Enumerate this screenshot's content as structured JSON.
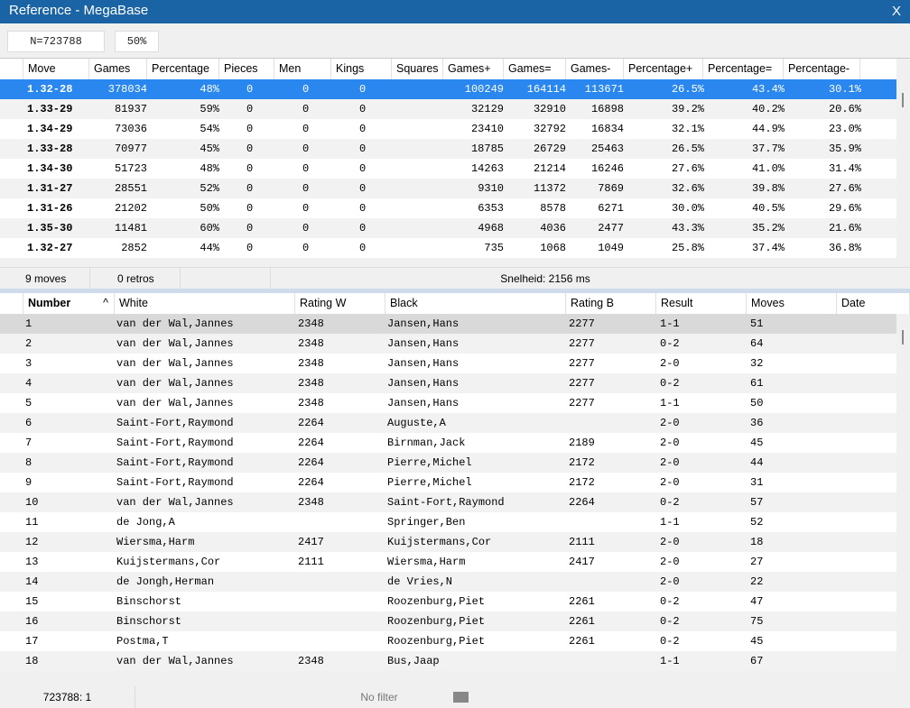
{
  "window": {
    "title": "Reference - MegaBase",
    "close_label": "X"
  },
  "toolbar": {
    "count_label": "N=723788",
    "percent_label": "50%"
  },
  "moves_table": {
    "columns": [
      "Move",
      "Games",
      "Percentage",
      "Pieces",
      "Men",
      "Kings",
      "Squares",
      "Games+",
      "Games=",
      "Games-",
      "Percentage+",
      "Percentage=",
      "Percentage-"
    ],
    "rows": [
      [
        "1.32-28",
        "378034",
        "48%",
        "0",
        "0",
        "0",
        "",
        "100249",
        "164114",
        "113671",
        "26.5%",
        "43.4%",
        "30.1%"
      ],
      [
        "1.33-29",
        "81937",
        "59%",
        "0",
        "0",
        "0",
        "",
        "32129",
        "32910",
        "16898",
        "39.2%",
        "40.2%",
        "20.6%"
      ],
      [
        "1.34-29",
        "73036",
        "54%",
        "0",
        "0",
        "0",
        "",
        "23410",
        "32792",
        "16834",
        "32.1%",
        "44.9%",
        "23.0%"
      ],
      [
        "1.33-28",
        "70977",
        "45%",
        "0",
        "0",
        "0",
        "",
        "18785",
        "26729",
        "25463",
        "26.5%",
        "37.7%",
        "35.9%"
      ],
      [
        "1.34-30",
        "51723",
        "48%",
        "0",
        "0",
        "0",
        "",
        "14263",
        "21214",
        "16246",
        "27.6%",
        "41.0%",
        "31.4%"
      ],
      [
        "1.31-27",
        "28551",
        "52%",
        "0",
        "0",
        "0",
        "",
        "9310",
        "11372",
        "7869",
        "32.6%",
        "39.8%",
        "27.6%"
      ],
      [
        "1.31-26",
        "21202",
        "50%",
        "0",
        "0",
        "0",
        "",
        "6353",
        "8578",
        "6271",
        "30.0%",
        "40.5%",
        "29.6%"
      ],
      [
        "1.35-30",
        "11481",
        "60%",
        "0",
        "0",
        "0",
        "",
        "4968",
        "4036",
        "2477",
        "43.3%",
        "35.2%",
        "21.6%"
      ],
      [
        "1.32-27",
        "2852",
        "44%",
        "0",
        "0",
        "0",
        "",
        "735",
        "1068",
        "1049",
        "25.8%",
        "37.4%",
        "36.8%"
      ]
    ],
    "selected_index": 0
  },
  "status_top": {
    "moves": "9 moves",
    "retros": "0 retros",
    "speed": "Snelheid: 2156 ms"
  },
  "games_table": {
    "columns": [
      "Number",
      "White",
      "Rating W",
      "Black",
      "Rating B",
      "Result",
      "Moves",
      "Date"
    ],
    "sort_indicator": "^",
    "rows": [
      [
        "1",
        "van der Wal,Jannes",
        "2348",
        "Jansen,Hans",
        "2277",
        "1-1",
        "51",
        ""
      ],
      [
        "2",
        "van der Wal,Jannes",
        "2348",
        "Jansen,Hans",
        "2277",
        "0-2",
        "64",
        ""
      ],
      [
        "3",
        "van der Wal,Jannes",
        "2348",
        "Jansen,Hans",
        "2277",
        "2-0",
        "32",
        ""
      ],
      [
        "4",
        "van der Wal,Jannes",
        "2348",
        "Jansen,Hans",
        "2277",
        "0-2",
        "61",
        ""
      ],
      [
        "5",
        "van der Wal,Jannes",
        "2348",
        "Jansen,Hans",
        "2277",
        "1-1",
        "50",
        ""
      ],
      [
        "6",
        "Saint-Fort,Raymond",
        "2264",
        "Auguste,A",
        "",
        "2-0",
        "36",
        ""
      ],
      [
        "7",
        "Saint-Fort,Raymond",
        "2264",
        "Birnman,Jack",
        "2189",
        "2-0",
        "45",
        ""
      ],
      [
        "8",
        "Saint-Fort,Raymond",
        "2264",
        "Pierre,Michel",
        "2172",
        "2-0",
        "44",
        ""
      ],
      [
        "9",
        "Saint-Fort,Raymond",
        "2264",
        "Pierre,Michel",
        "2172",
        "2-0",
        "31",
        ""
      ],
      [
        "10",
        "van der Wal,Jannes",
        "2348",
        "Saint-Fort,Raymond",
        "2264",
        "0-2",
        "57",
        ""
      ],
      [
        "11",
        "de Jong,A",
        "",
        "Springer,Ben",
        "",
        "1-1",
        "52",
        ""
      ],
      [
        "12",
        "Wiersma,Harm",
        "2417",
        "Kuijstermans,Cor",
        "2111",
        "2-0",
        "18",
        ""
      ],
      [
        "13",
        "Kuijstermans,Cor",
        "2111",
        "Wiersma,Harm",
        "2417",
        "2-0",
        "27",
        ""
      ],
      [
        "14",
        "de Jongh,Herman",
        "",
        "de Vries,N",
        "",
        "2-0",
        "22",
        ""
      ],
      [
        "15",
        "Binschorst",
        "",
        "Roozenburg,Piet",
        "2261",
        "0-2",
        "47",
        ""
      ],
      [
        "16",
        "Binschorst",
        "",
        "Roozenburg,Piet",
        "2261",
        "0-2",
        "75",
        ""
      ],
      [
        "17",
        "Postma,T",
        "",
        "Roozenburg,Piet",
        "2261",
        "0-2",
        "45",
        ""
      ],
      [
        "18",
        "van der Wal,Jannes",
        "2348",
        "Bus,Jaap",
        "",
        "1-1",
        "67",
        ""
      ]
    ],
    "current_index": 0
  },
  "status_bottom": {
    "position": "723788: 1",
    "filter": "No filter"
  },
  "colors": {
    "titlebar": "#1a63a5",
    "selection": "#2a87f0",
    "current_row": "#d9d9d9",
    "splitter": "#cddbea"
  }
}
